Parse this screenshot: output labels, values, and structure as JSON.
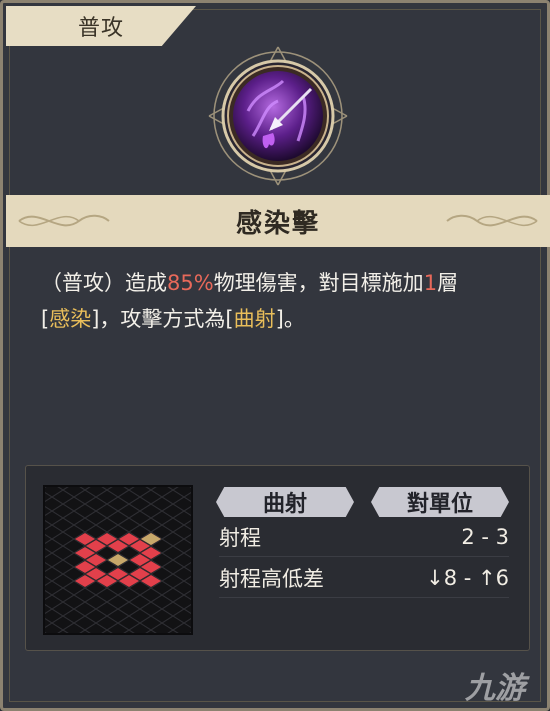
{
  "skill": {
    "type_tab": "普攻",
    "name": "感染擊",
    "description": {
      "part1": "（普攻）造成",
      "damage_pct": "85%",
      "part2": "物理傷害，對目標施加",
      "stack_count": "1",
      "part3": "層",
      "bracket_open_1": "[",
      "status_name": "感染",
      "bracket_close_1": "]",
      "part4": "，攻擊方式為",
      "bracket_open_2": "[",
      "attack_type": "曲射",
      "bracket_close_2": "]",
      "part5": "。"
    },
    "icon": "purple-poison-arrow-icon",
    "accent_colors": {
      "damage": "#e8695a",
      "keyword": "#e9be5a",
      "range_tile": "#e2404b",
      "center_tile": "#c7a86a"
    }
  },
  "info": {
    "tag_attack_type": "曲射",
    "tag_target": "對單位",
    "range_label": "射程",
    "range_value": "2 - 3",
    "height_label": "射程高低差",
    "height_value": "↓8 - ↑6"
  },
  "watermark": "九游"
}
